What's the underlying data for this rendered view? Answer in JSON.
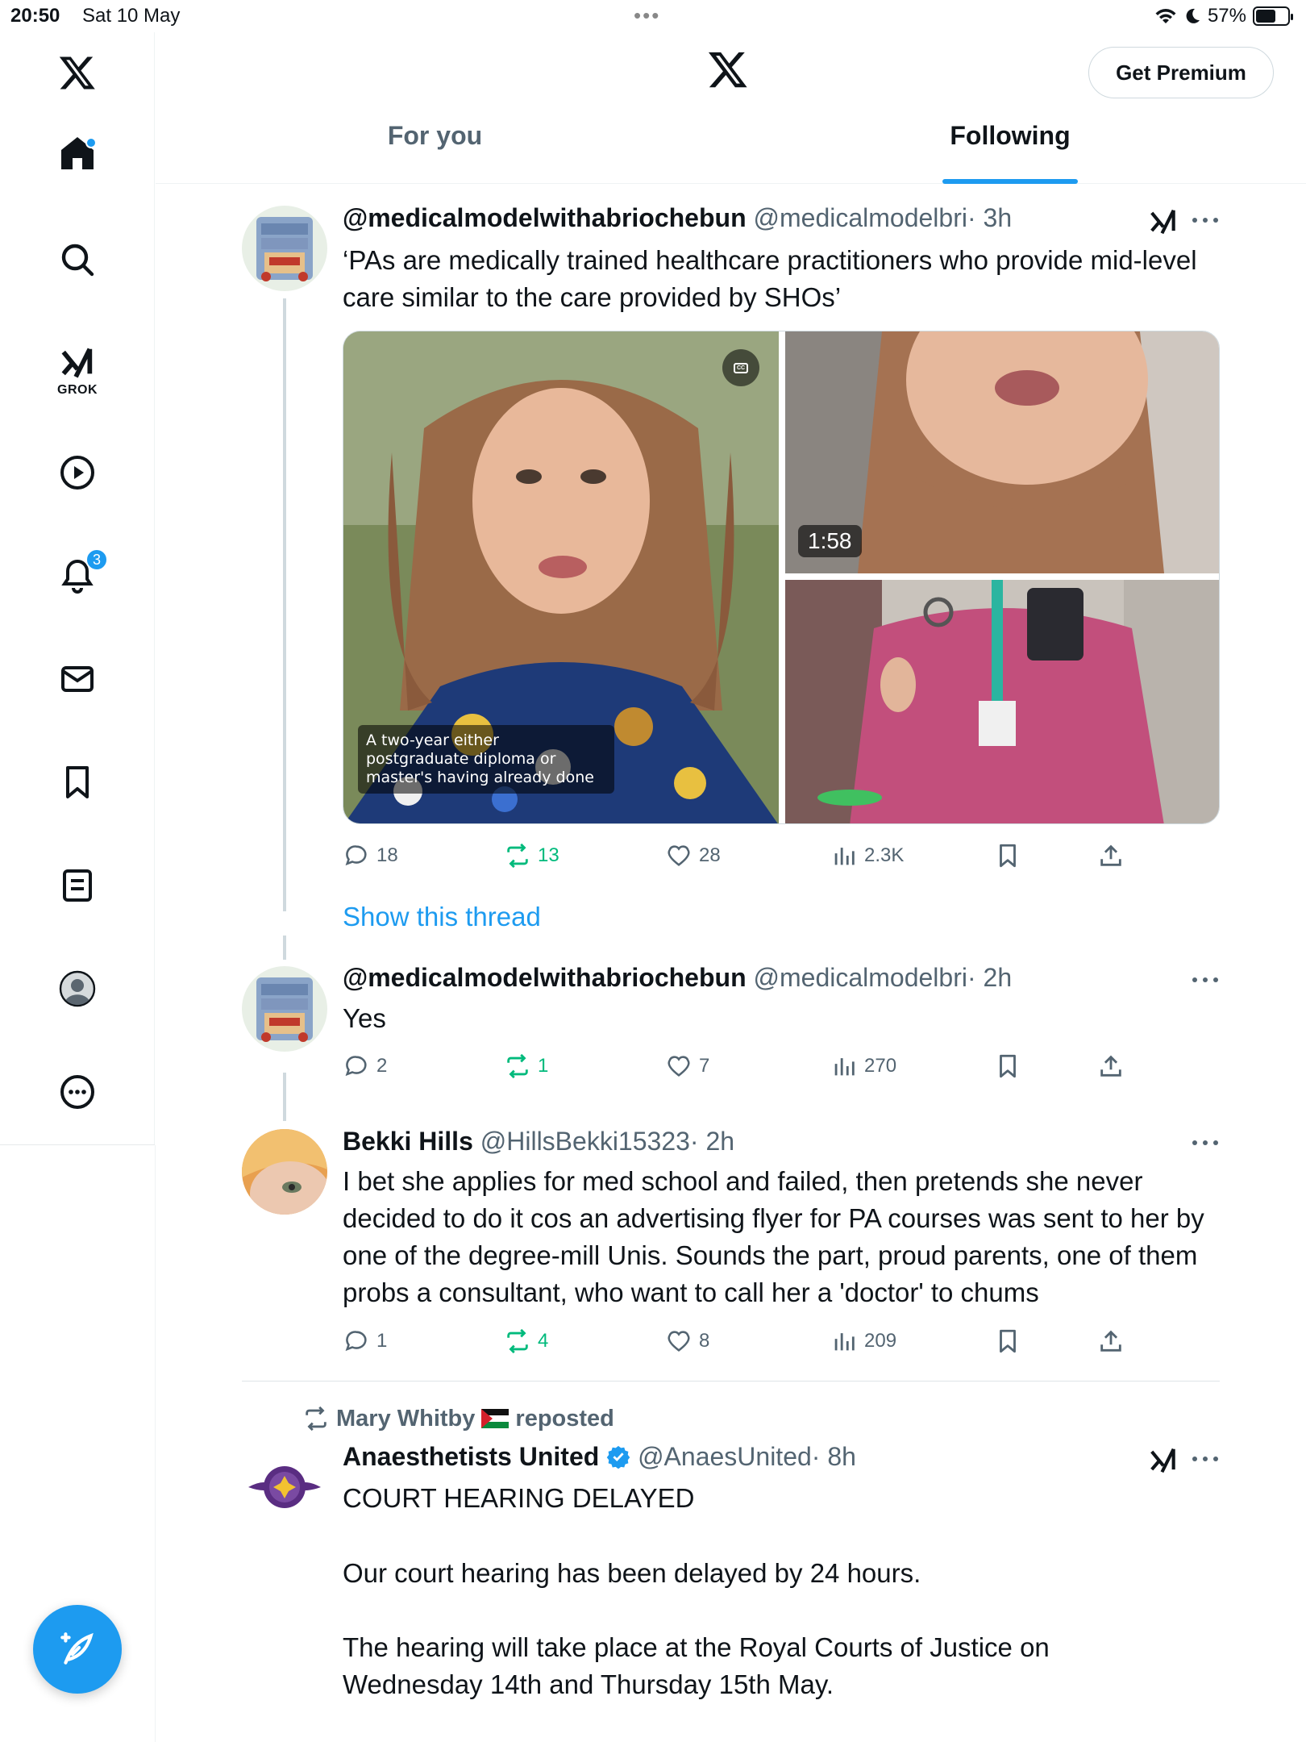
{
  "status_bar": {
    "time": "20:50",
    "date": "Sat 10 May",
    "dots": "•••",
    "battery": "57%",
    "battery_level": 0.57
  },
  "header": {
    "premium_label": "Get Premium",
    "tabs": [
      "For you",
      "Following"
    ],
    "active_tab": "Following"
  },
  "sidebar": {
    "items": [
      {
        "icon": "x-logo-icon"
      },
      {
        "icon": "home-icon",
        "dot": true
      },
      {
        "icon": "search-icon"
      },
      {
        "icon": "grok-icon",
        "label": "GROK"
      },
      {
        "icon": "video-icon"
      },
      {
        "icon": "notifications-icon",
        "badge": "3"
      },
      {
        "icon": "messages-icon"
      },
      {
        "icon": "bookmarks-icon"
      },
      {
        "icon": "lists-icon"
      },
      {
        "icon": "profile-icon"
      },
      {
        "icon": "more-icon"
      }
    ],
    "compose_icon": "compose-icon"
  },
  "tweets": [
    {
      "name": "@medicalmodelwithabriochebun",
      "handle": "@medicalmodelbri",
      "time": "· 3h",
      "text": "‘PAs are medically trained healthcare practitioners who provide mid-level care similar to the care provided by SHOs’",
      "media": {
        "caption": "A two-year either postgraduate diploma or master's having already done",
        "duration": "1:58"
      },
      "replies": "18",
      "reposts": "13",
      "likes": "28",
      "views": "2.3K",
      "show_thread": "Show this thread"
    },
    {
      "name": "@medicalmodelwithabriochebun",
      "handle": "@medicalmodelbri",
      "time": "· 2h",
      "text": "Yes",
      "replies": "2",
      "reposts": "1",
      "likes": "7",
      "views": "270"
    },
    {
      "name": "Bekki Hills",
      "handle": "@HillsBekki15323",
      "time": "· 2h",
      "text": "I bet she applies for med school and failed, then pretends she never decided to do it cos an advertising flyer for PA courses was sent to her by one of the degree-mill Unis. Sounds the part, proud parents, one of them probs a consultant, who want to call her a 'doctor' to chums",
      "replies": "1",
      "reposts": "4",
      "likes": "8",
      "views": "209"
    },
    {
      "repost_by": "Mary Whitby",
      "repost_label": "reposted",
      "name": "Anaesthetists United",
      "handle": "@AnaesUnited",
      "time": "· 8h",
      "text_lines": [
        "COURT HEARING DELAYED",
        "Our court hearing has been delayed by 24 hours.",
        "The hearing will take place  at the Royal Courts of Justice on Wednesday 14th and Thursday  15th May."
      ]
    }
  ],
  "colors": {
    "accent": "#1d9bf0",
    "repost_green": "#00ba7c",
    "muted": "#536471",
    "text": "#0f1419"
  }
}
